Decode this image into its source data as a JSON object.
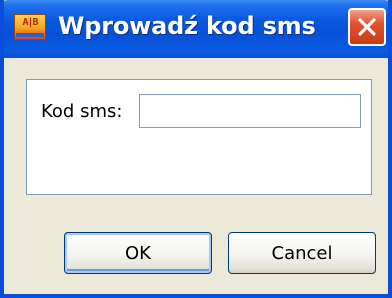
{
  "window": {
    "title": "Wprowadź kod sms",
    "icon": "app-icon",
    "icon_text": "A|B",
    "close_icon": "close-icon"
  },
  "form": {
    "label": "Kod sms:",
    "value": "",
    "placeholder": ""
  },
  "buttons": {
    "ok": "OK",
    "cancel": "Cancel"
  },
  "colors": {
    "titlebar": "#0851d6",
    "frame": "#0a4fd9",
    "dialog_bg": "#ece9d8",
    "close_button": "#e0532f",
    "input_border": "#7f9db9"
  }
}
